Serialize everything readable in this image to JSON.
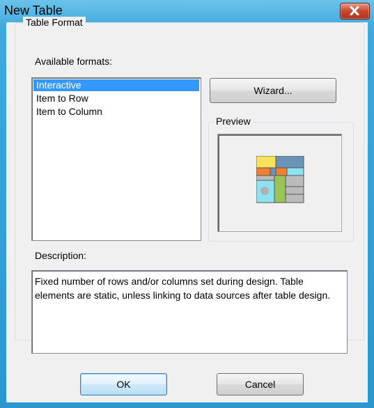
{
  "window": {
    "title": "New Table"
  },
  "group": {
    "title": "Table Format"
  },
  "formats": {
    "label": "Available formats:",
    "items": [
      {
        "label": "Interactive",
        "selected": true
      },
      {
        "label": "Item to Row",
        "selected": false
      },
      {
        "label": "Item to Column",
        "selected": false
      }
    ]
  },
  "buttons": {
    "wizard": "Wizard...",
    "ok": "OK",
    "cancel": "Cancel"
  },
  "preview": {
    "label": "Preview",
    "icon": "table-layout-icon"
  },
  "description": {
    "label": "Description:",
    "text": "Fixed number of rows and/or columns set during design. Table elements are static, unless linking to data sources after table design."
  },
  "colors": {
    "selection": "#3399ff",
    "close": "#c8472f",
    "titlebar": "#3ea9dd"
  }
}
